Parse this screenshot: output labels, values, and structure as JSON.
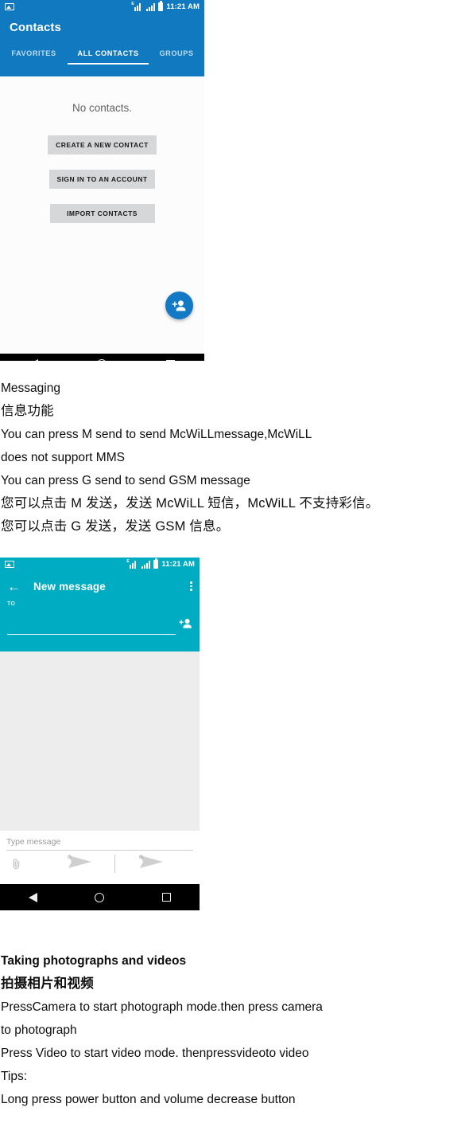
{
  "document": {
    "messaging_section": {
      "heading_en": "Messaging",
      "heading_zh": "信息功能",
      "lines": [
        "You can press M send to send McWiLLmessage,McWiLL",
        "does not support MMS",
        "You can press G send to send GSM message",
        "您可以点击 M 发送，发送 McWiLL 短信，McWiLL 不支持彩信。",
        "您可以点击 G 发送，发送 GSM 信息。"
      ]
    },
    "camera_section": {
      "heading_en": "Taking photographs and videos",
      "heading_zh": "拍摄相片和视频",
      "lines": [
        "PressCamera to start photograph mode.then press camera",
        "to photograph",
        "Press Video to start video mode. thenpressvideoto video",
        "Tips:",
        "Long press power button and volume decrease button"
      ]
    }
  },
  "contacts_screenshot": {
    "colors": {
      "appbar": "#1179c0",
      "fab": "#1479c4",
      "body": "#fcfcfc",
      "navbar": "#000000"
    },
    "status_bar": {
      "time": "11:21 AM",
      "signal_label": "E",
      "icons": [
        "photo-icon",
        "signal-e-icon",
        "signal-icon",
        "battery-icon"
      ]
    },
    "app_title": "Contacts",
    "tabs": [
      {
        "label": "FAVORITES",
        "active": false
      },
      {
        "label": "ALL CONTACTS",
        "active": true
      },
      {
        "label": "GROUPS",
        "active": false
      }
    ],
    "empty_state": "No contacts.",
    "buttons": [
      "CREATE A NEW CONTACT",
      "SIGN IN TO AN ACCOUNT",
      "IMPORT CONTACTS"
    ],
    "fab_icon": "add-person-icon",
    "nav_bar": [
      "back-icon",
      "home-icon",
      "recents-icon"
    ]
  },
  "messaging_screenshot": {
    "colors": {
      "appbar": "#00acc1",
      "conversation": "#ededed",
      "compose": "#ffffff",
      "navbar": "#000000"
    },
    "status_bar": {
      "time": "11:21 AM",
      "signal_label": "E",
      "icons": [
        "photo-icon",
        "signal-e-icon",
        "signal-icon",
        "battery-icon"
      ]
    },
    "app_title": "New message",
    "back_icon": "arrow-left-icon",
    "overflow_icon": "more-vertical-icon",
    "to_label": "TO",
    "to_value": "",
    "add_recipient_icon": "add-person-icon",
    "compose_placeholder": "Type message",
    "compose_value": "",
    "attach_icon": "paperclip-icon",
    "send_gsm": {
      "icon": "send-icon",
      "tag": "G"
    },
    "send_mcwill": {
      "icon": "send-icon",
      "tag": "M"
    },
    "nav_bar": [
      "back-icon",
      "home-icon",
      "recents-icon"
    ]
  }
}
